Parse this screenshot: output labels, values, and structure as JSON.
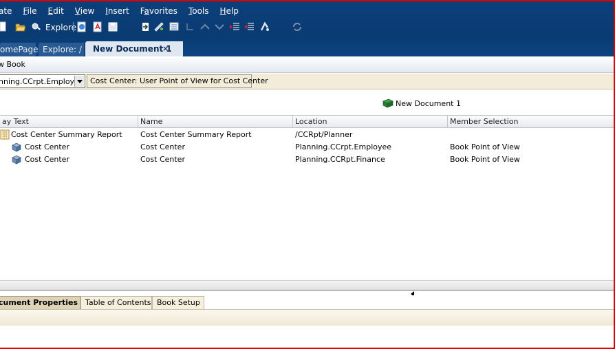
{
  "menubar": {
    "items": [
      {
        "label": "ate",
        "underline": ""
      },
      {
        "label": "File",
        "underline": "F"
      },
      {
        "label": "Edit",
        "underline": "E"
      },
      {
        "label": "View",
        "underline": "V"
      },
      {
        "label": "Insert",
        "underline": "I"
      },
      {
        "label": "Favorites",
        "underline": "a"
      },
      {
        "label": "Tools",
        "underline": "T"
      },
      {
        "label": "Help",
        "underline": "H"
      }
    ]
  },
  "toolbar": {
    "explore_label": "Explore"
  },
  "tabs": {
    "items": [
      {
        "label": "omePage"
      },
      {
        "label": "Explore: /"
      },
      {
        "label": "New Document 1"
      }
    ],
    "close_glyph": "×"
  },
  "subhead": {
    "title": "w Book"
  },
  "pov": {
    "select_value": "nning.CCrpt.Employee",
    "button_label": "Cost Center: User Point of View for Cost Center"
  },
  "document": {
    "label": "New Document 1"
  },
  "table": {
    "columns": [
      "ay Text",
      "Name",
      "Location",
      "Member Selection"
    ],
    "rows": [
      {
        "icon": "report-icon",
        "display": "Cost Center Summary Report",
        "name": "Cost Center Summary Report",
        "location": "/CCRpt/Planner",
        "member": ""
      },
      {
        "icon": "dimension-icon",
        "display": "Cost Center",
        "name": "Cost Center",
        "location": "Planning.CCrpt.Employee",
        "member": "Book Point of View"
      },
      {
        "icon": "dimension-icon",
        "display": "Cost Center",
        "name": "Cost Center",
        "location": "Planning.CCRpt.Finance",
        "member": "Book Point of View"
      }
    ]
  },
  "bottom_tabs": {
    "items": [
      {
        "label": "cument Properties"
      },
      {
        "label": "Table of Contents"
      },
      {
        "label": "Book Setup"
      }
    ]
  },
  "colors": {
    "accent": "#0a3b72",
    "frame": "#e00000",
    "pov_background": "#f2ecd9"
  }
}
